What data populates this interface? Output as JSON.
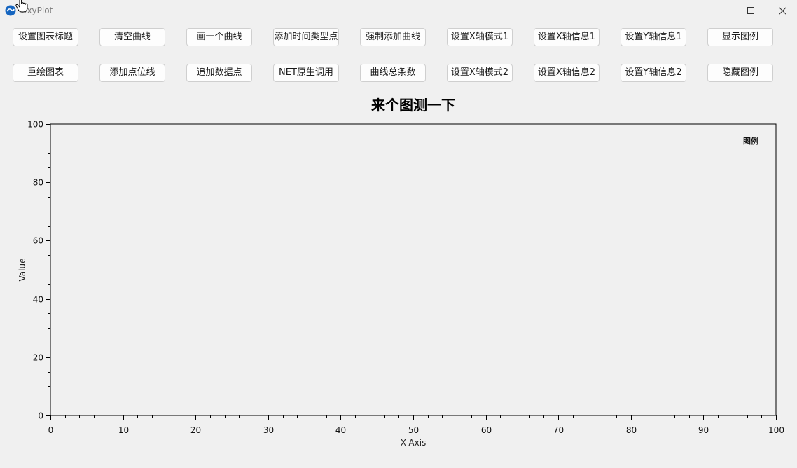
{
  "window": {
    "title": "OxyPlot"
  },
  "toolbar": {
    "row1": [
      "设置图表标题",
      "清空曲线",
      "画一个曲线",
      "添加时间类型点",
      "强制添加曲线",
      "设置X轴模式1",
      "设置X轴信息1",
      "设置Y轴信息1",
      "显示图例"
    ],
    "row2": [
      "重绘图表",
      "添加点位线",
      "追加数据点",
      "NET原生调用",
      "曲线总条数",
      "设置X轴模式2",
      "设置X轴信息2",
      "设置Y轴信息2",
      "隐藏图例"
    ]
  },
  "icons": {
    "app": "oxyplot-logo-icon",
    "cursor": "hand-pointer-icon",
    "minimize": "minimize-icon",
    "maximize": "maximize-icon",
    "close": "close-icon"
  },
  "chart_data": {
    "type": "line",
    "title": "来个图测一下",
    "xlabel": "X-Axis",
    "ylabel": "Value",
    "xlim": [
      0,
      100
    ],
    "ylim": [
      0,
      100
    ],
    "x_major_ticks": [
      "0",
      "10",
      "20",
      "30",
      "40",
      "50",
      "60",
      "70",
      "80",
      "90",
      "100"
    ],
    "y_major_ticks": [
      "0",
      "20",
      "40",
      "60",
      "80",
      "100"
    ],
    "legend_title": "图例",
    "legend_position": "top-right",
    "series": [],
    "grid": false
  }
}
